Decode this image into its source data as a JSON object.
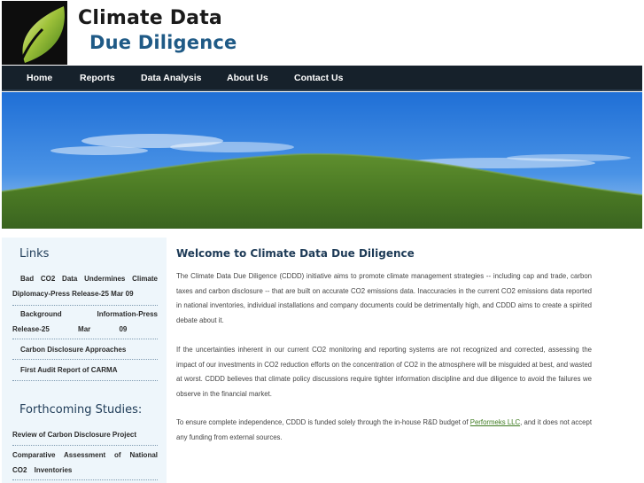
{
  "colors": {
    "nav_bg": "#16212b",
    "title_blue": "#1f5a86",
    "sidebar_bg": "#eef6fb",
    "link_green": "#3d7a20"
  },
  "header": {
    "title_line1": "Climate Data",
    "title_line2": "Due Diligence",
    "logo_icon": "leaf-icon"
  },
  "nav": {
    "items": [
      {
        "label": "Home"
      },
      {
        "label": "Reports"
      },
      {
        "label": "Data Analysis"
      },
      {
        "label": "About Us"
      },
      {
        "label": "Contact Us"
      }
    ]
  },
  "hero": {
    "image": "green-hill-under-blue-sky"
  },
  "sidebar": {
    "links_heading": "Links",
    "links": [
      {
        "label": "Bad CO2 Data Undermines Climate Diplomacy-Press Release-25 Mar 09"
      },
      {
        "label": "Background Information-Press Release-25 Mar 09"
      },
      {
        "label": "Carbon Disclosure Approaches"
      },
      {
        "label": "First Audit Report of CARMA"
      }
    ],
    "studies_heading": "Forthcoming Studies:",
    "studies": [
      {
        "label": "Review of Carbon Disclosure Project"
      },
      {
        "label": "Comparative Assessment of National CO2 Inventories"
      }
    ]
  },
  "main": {
    "heading": "Welcome to Climate Data Due Diligence",
    "para1": "The Climate Data Due Diligence (CDDD) initiative aims to promote climate management strategies -- including cap and trade, carbon taxes and carbon disclosure -- that are built on accurate CO2 emissions data. Inaccuracies in the current CO2 emissions data reported in national inventories, individual installations and company documents could be detrimentally high, and CDDD aims to create a spirited debate about it.",
    "para2": "If the uncertainties inherent in our current CO2 monitoring and reporting systems are not recognized and corrected, assessing the impact of our investments in CO2 reduction efforts on the concentration of CO2 in the atmosphere will be misguided at best, and wasted at worst. CDDD believes that climate policy discussions require tighter information discipline and due diligence to avoid the failures we observe in the financial market.",
    "para3_before": "To ensure complete independence, CDDD is funded solely through the in-house R&D budget of ",
    "para3_link": "Performeks LLC",
    "para3_after": ", and it does not accept any funding from external sources."
  }
}
